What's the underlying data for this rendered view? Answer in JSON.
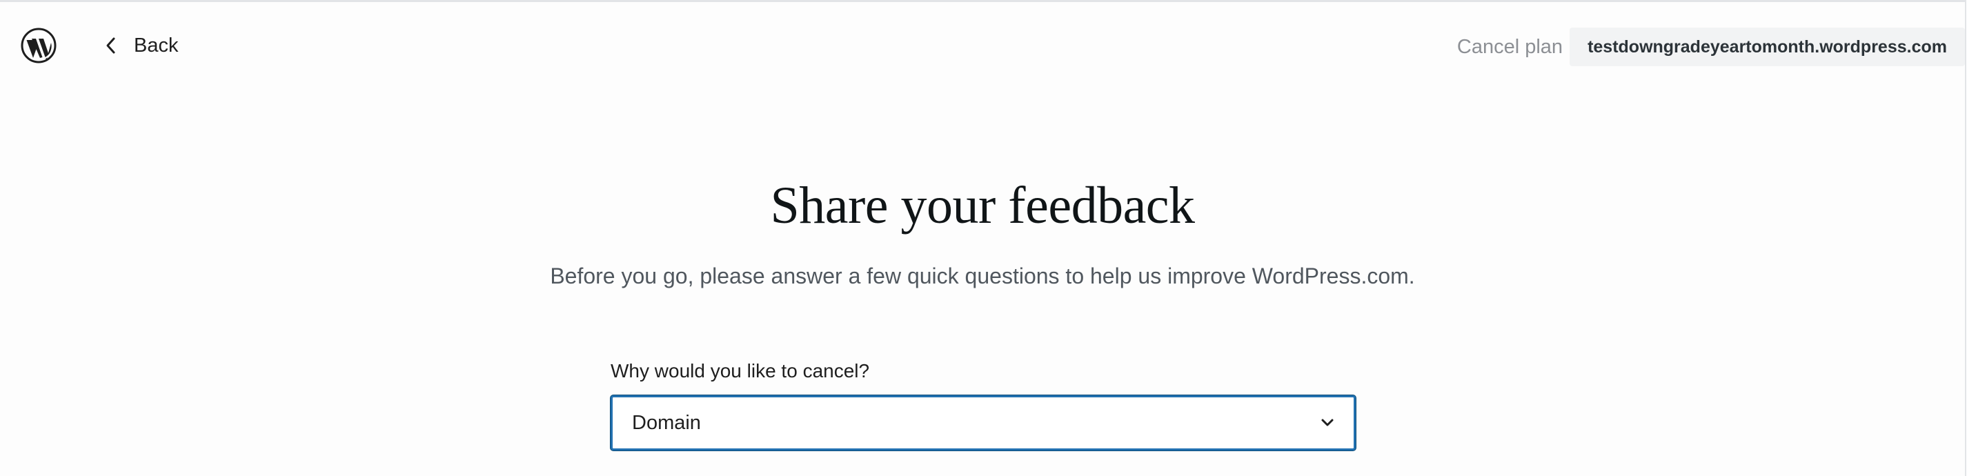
{
  "header": {
    "logo_icon": "wordpress-logo-icon",
    "back_label": "Back",
    "cancel_plan_label": "Cancel plan",
    "site_domain": "testdowngradeyeartomonth.wordpress.com"
  },
  "main": {
    "title": "Share your feedback",
    "subtitle": "Before you go, please answer a few quick questions to help us improve WordPress.com.",
    "reason_question": "Why would you like to cancel?",
    "reason_selected": "Domain"
  },
  "colors": {
    "focus_border": "#2271b1",
    "muted_text": "#8c8f94",
    "pill_bg": "#f2f3f4"
  }
}
